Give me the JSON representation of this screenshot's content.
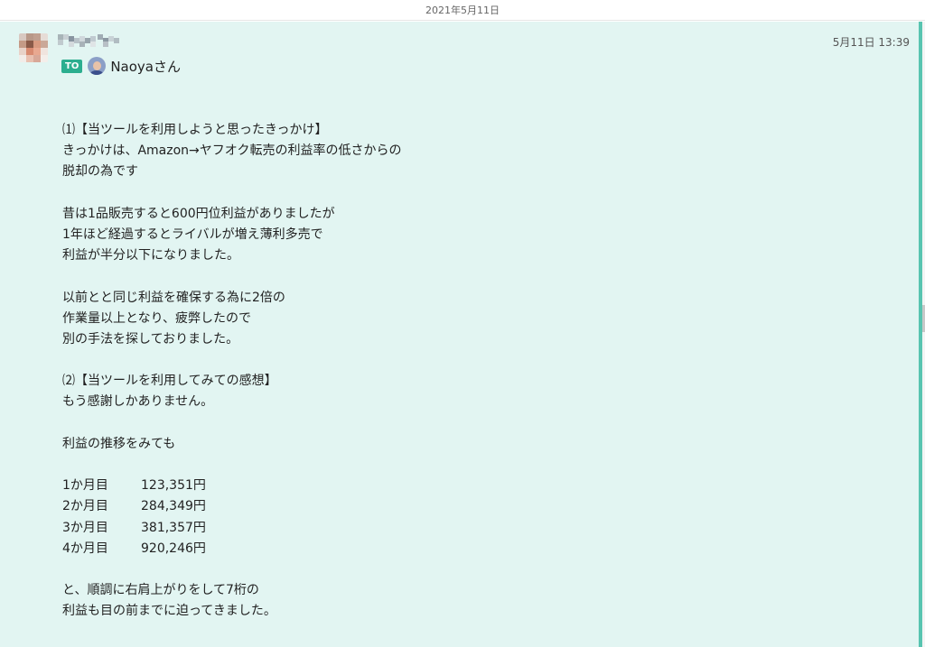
{
  "date_header": "2021年5月11日",
  "message": {
    "timestamp": "5月11日 13:39",
    "to_label": "TO",
    "to_name": "Naoyaさん",
    "lines": [
      "",
      "",
      "⑴【当ツールを利用しようと思ったきっかけ】",
      "きっかけは、Amazon→ヤフオク転売の利益率の低さからの",
      "脱却の為です",
      "",
      "昔は1品販売すると600円位利益がありましたが",
      "1年ほど経過するとライバルが増え薄利多売で",
      "利益が半分以下になりました。",
      "",
      "以前とと同じ利益を確保する為に2倍の",
      "作業量以上となり、疲弊したので",
      "別の手法を探しておりました。",
      "",
      "⑵【当ツールを利用してみての感想】",
      "もう感謝しかありません。",
      "",
      "利益の推移をみても",
      ""
    ],
    "profits": [
      {
        "month": "1か月目",
        "amount": "123,351円"
      },
      {
        "month": "2か月目",
        "amount": "284,349円"
      },
      {
        "month": "3か月目",
        "amount": "381,357円"
      },
      {
        "month": "4か月目",
        "amount": "920,246円"
      }
    ],
    "closing_lines": [
      "",
      "と、順調に右肩上がりをして7桁の",
      "利益も目の前までに迫ってきました。"
    ]
  },
  "colors": {
    "message_bg": "#e2f5f2",
    "accent": "#58c4b0",
    "to_badge": "#2cae8f"
  }
}
